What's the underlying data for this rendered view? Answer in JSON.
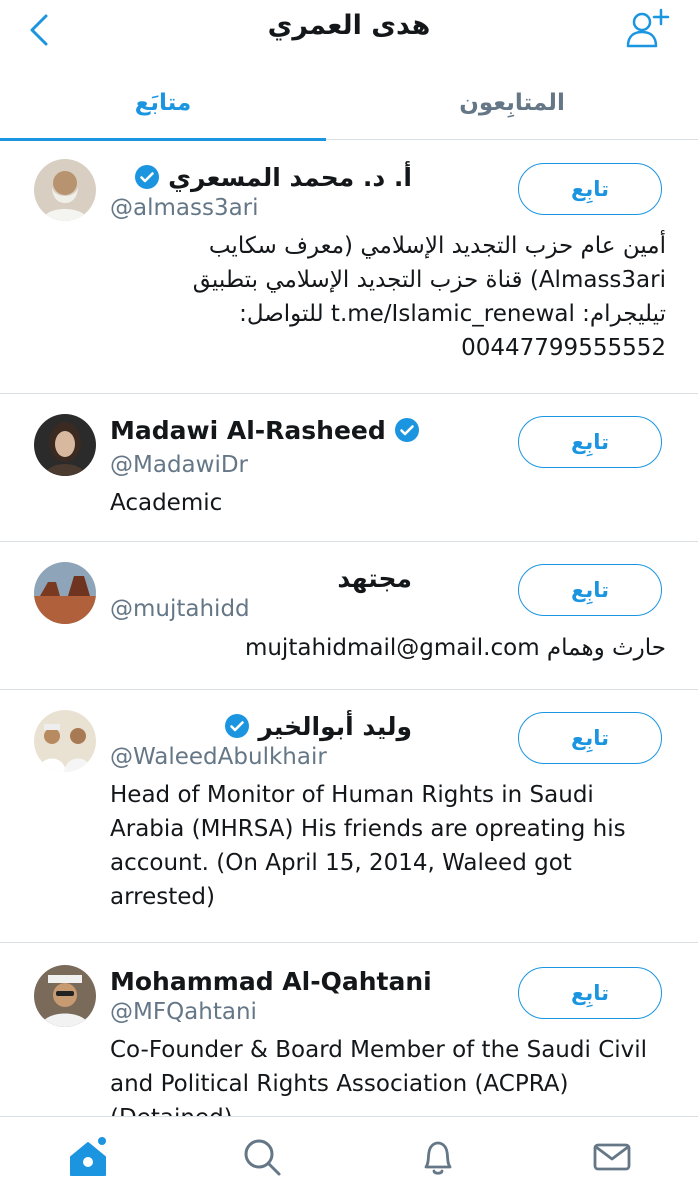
{
  "header": {
    "title": "هدى العمري",
    "back_icon": "chevron-left-icon",
    "add_user_icon": "add-user-icon"
  },
  "tabs": [
    {
      "label": "متابَع",
      "active": true
    },
    {
      "label": "المتابِعون",
      "active": false
    }
  ],
  "colors": {
    "accent": "#1b95e0",
    "secondary_text": "#657786",
    "divider": "#d9dfe3"
  },
  "users": [
    {
      "name": "أ. د. محمد المسعري",
      "verified": true,
      "handle": "@almass3ari",
      "bio": "أمين عام حزب التجديد الإسلامي (معرف سكايب Almass3ari) قناة حزب التجديد الإسلامي بتطبيق تيليجرام: t.me/Islamic_renewal للتواصل: 00447799555552",
      "follow_label": "تابِع"
    },
    {
      "name": "Madawi Al-Rasheed",
      "verified": true,
      "handle": "@MadawiDr",
      "bio": "Academic",
      "follow_label": "تابِع"
    },
    {
      "name": "مجتهد",
      "verified": false,
      "handle": "@mujtahidd",
      "bio": "حارث وهمام mujtahidmail@gmail.com",
      "follow_label": "تابِع"
    },
    {
      "name": "وليد أبوالخير",
      "verified": true,
      "handle": "@WaleedAbulkhair",
      "bio": "Head of Monitor of Human Rights in Saudi Arabia (MHRSA) His friends are opreating his account. (On April 15, 2014, Waleed got arrested)",
      "follow_label": "تابِع"
    },
    {
      "name": "Mohammad Al-Qahtani",
      "verified": false,
      "handle": "@MFQahtani",
      "bio": "Co-Founder & Board Member of the Saudi Civil and Political Rights Association (ACPRA) (Detained)",
      "follow_label": "تابِع"
    }
  ],
  "bottom_nav": [
    {
      "icon": "home-icon",
      "active": true
    },
    {
      "icon": "search-icon",
      "active": false
    },
    {
      "icon": "notifications-icon",
      "active": false
    },
    {
      "icon": "messages-icon",
      "active": false
    }
  ]
}
